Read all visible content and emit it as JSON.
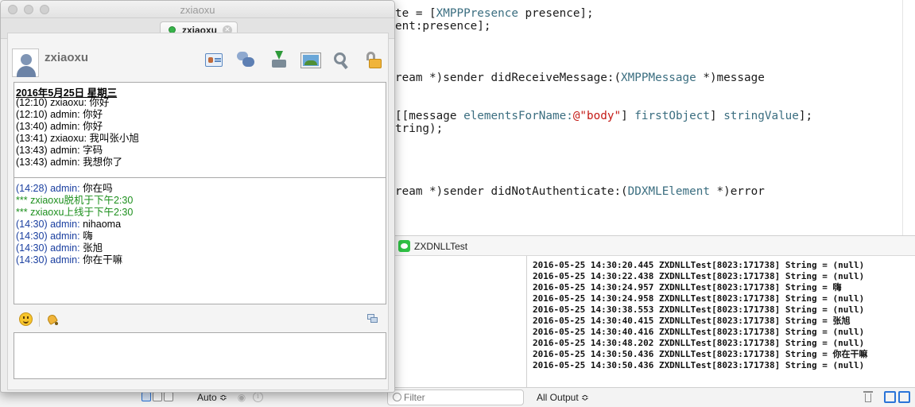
{
  "editor": {
    "lines": [
      [
        {
          "t": "te = [",
          "c": ""
        },
        {
          "t": "XMPPPresence",
          "c": "cls"
        },
        {
          "t": " presence];",
          "c": ""
        }
      ],
      [
        {
          "t": "ent:presence];",
          "c": ""
        }
      ],
      [
        {
          "t": "ream *)sender didReceiveMessage:(",
          "c": ""
        },
        {
          "t": "XMPPMessage",
          "c": "cls"
        },
        {
          "t": " *)message",
          "c": ""
        }
      ],
      [
        {
          "t": "[[message ",
          "c": ""
        },
        {
          "t": "elementsForName:",
          "c": "cls"
        },
        {
          "t": "@\"body\"",
          "c": "str"
        },
        {
          "t": "] ",
          "c": ""
        },
        {
          "t": "firstObject",
          "c": "cls"
        },
        {
          "t": "] ",
          "c": ""
        },
        {
          "t": "stringValue",
          "c": "cls"
        },
        {
          "t": "];",
          "c": ""
        }
      ],
      [
        {
          "t": "tring);",
          "c": ""
        }
      ],
      [
        {
          "t": "ream *)sender didNotAuthenticate:(",
          "c": ""
        },
        {
          "t": "DDXMLElement",
          "c": "cls"
        },
        {
          "t": " *)error",
          "c": ""
        }
      ]
    ]
  },
  "debug": {
    "app_name": "ZXDNLLTest",
    "console_lines": [
      "2016-05-25 14:30:20.445 ZXDNLLTest[8023:171738] String = (null)",
      "2016-05-25 14:30:22.438 ZXDNLLTest[8023:171738] String = (null)",
      "2016-05-25 14:30:24.957 ZXDNLLTest[8023:171738] String = 嗨",
      "2016-05-25 14:30:24.958 ZXDNLLTest[8023:171738] String = (null)",
      "2016-05-25 14:30:38.553 ZXDNLLTest[8023:171738] String = (null)",
      "2016-05-25 14:30:40.415 ZXDNLLTest[8023:171738] String = 张旭",
      "2016-05-25 14:30:40.416 ZXDNLLTest[8023:171738] String = (null)",
      "2016-05-25 14:30:48.202 ZXDNLLTest[8023:171738] String = (null)",
      "2016-05-25 14:30:50.436 ZXDNLLTest[8023:171738] String = 你在干嘛",
      "2016-05-25 14:30:50.436 ZXDNLLTest[8023:171738] String = (null)"
    ]
  },
  "bottom_bar": {
    "auto_label": "Auto ≎",
    "filter_placeholder": "Filter",
    "output_label": "All Output ≎"
  },
  "chat": {
    "window_title": "zxiaoxu",
    "tab_label": "zxiaoxu",
    "contact_name": "zxiaoxu",
    "transcript_date": "2016年5月25日 星期三",
    "history": [
      {
        "meta": "(12:10) zxiaoxu:",
        "text": " 你好"
      },
      {
        "meta": "(12:10) admin:",
        "text": " 你好"
      },
      {
        "meta": "(13:40) admin:",
        "text": " 你好"
      },
      {
        "meta": "(13:41) zxiaoxu:",
        "text": " 我叫张小旭"
      },
      {
        "meta": "(13:43) admin:",
        "text": " 字码"
      },
      {
        "meta": "(13:43) admin:",
        "text": " 我想你了"
      }
    ],
    "recent": [
      {
        "kind": "new",
        "meta": "(14:28) admin:",
        "text": " 你在吗"
      },
      {
        "kind": "sys",
        "meta": "*** zxiaoxu脱机于下午2:30",
        "text": ""
      },
      {
        "kind": "sys",
        "meta": "*** zxiaoxu上线于下午2:30",
        "text": ""
      },
      {
        "kind": "new",
        "meta": "(14:30) admin:",
        "text": " nihaoma"
      },
      {
        "kind": "new",
        "meta": "(14:30) admin:",
        "text": " 嗨"
      },
      {
        "kind": "new",
        "meta": "(14:30) admin:",
        "text": " 张旭"
      },
      {
        "kind": "new",
        "meta": "(14:30) admin:",
        "text": " 你在干嘛"
      }
    ],
    "input_value": "",
    "colors": {
      "admin_meta": "#1a3fa0",
      "system": "#1c8f1c",
      "status_online": "#37b34a"
    }
  },
  "icons": [
    "user-avatar-icon",
    "contact-card-icon",
    "chat-bubbles-icon",
    "download-icon",
    "image-icon",
    "settings-icon",
    "lock-icon",
    "emoji-icon",
    "bell-icon",
    "screen-share-icon",
    "trash-icon",
    "eye-icon",
    "info-icon",
    "filter-icon"
  ]
}
